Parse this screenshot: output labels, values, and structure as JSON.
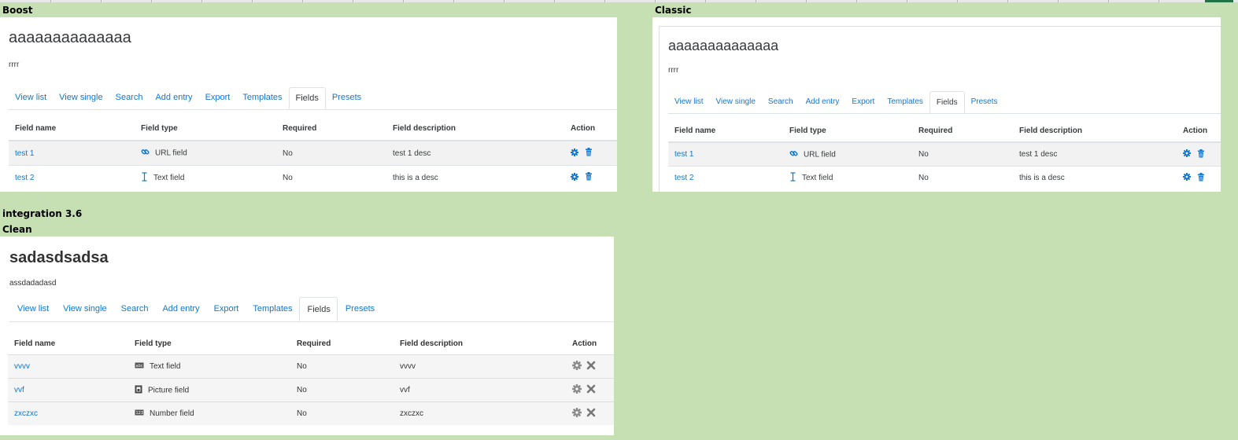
{
  "labels": {
    "boost": "Boost",
    "classic": "Classic",
    "integration": "integration 3.6",
    "clean": "Clean"
  },
  "boost": {
    "title": "aaaaaaaaaaaaaa",
    "description": "rrrr",
    "tabs": [
      {
        "label": "View list",
        "active": false
      },
      {
        "label": "View single",
        "active": false
      },
      {
        "label": "Search",
        "active": false
      },
      {
        "label": "Add entry",
        "active": false
      },
      {
        "label": "Export",
        "active": false
      },
      {
        "label": "Templates",
        "active": false
      },
      {
        "label": "Fields",
        "active": true
      },
      {
        "label": "Presets",
        "active": false
      }
    ],
    "headers": [
      "Field name",
      "Field type",
      "Required",
      "Field description",
      "Action"
    ],
    "rows": [
      {
        "name": "test 1",
        "type_icon": "link-icon",
        "type": "URL field",
        "required": "No",
        "description": "test 1 desc"
      },
      {
        "name": "test 2",
        "type_icon": "text-cursor-icon",
        "type": "Text field",
        "required": "No",
        "description": "this is a desc"
      }
    ]
  },
  "classic": {
    "title": "aaaaaaaaaaaaaa",
    "description": "rrrr",
    "tabs": [
      {
        "label": "View list",
        "active": false
      },
      {
        "label": "View single",
        "active": false
      },
      {
        "label": "Search",
        "active": false
      },
      {
        "label": "Add entry",
        "active": false
      },
      {
        "label": "Export",
        "active": false
      },
      {
        "label": "Templates",
        "active": false
      },
      {
        "label": "Fields",
        "active": true
      },
      {
        "label": "Presets",
        "active": false
      }
    ],
    "headers": [
      "Field name",
      "Field type",
      "Required",
      "Field description",
      "Action"
    ],
    "rows": [
      {
        "name": "test 1",
        "type_icon": "link-icon",
        "type": "URL field",
        "required": "No",
        "description": "test 1 desc"
      },
      {
        "name": "test 2",
        "type_icon": "text-cursor-icon",
        "type": "Text field",
        "required": "No",
        "description": "this is a desc"
      }
    ]
  },
  "clean": {
    "title": "sadasdsadsa",
    "description": "assdadadasd",
    "tabs": [
      {
        "label": "View list",
        "active": false
      },
      {
        "label": "View single",
        "active": false
      },
      {
        "label": "Search",
        "active": false
      },
      {
        "label": "Add entry",
        "active": false
      },
      {
        "label": "Export",
        "active": false
      },
      {
        "label": "Templates",
        "active": false
      },
      {
        "label": "Fields",
        "active": true
      },
      {
        "label": "Presets",
        "active": false
      }
    ],
    "headers": [
      "Field name",
      "Field type",
      "Required",
      "Field description",
      "Action"
    ],
    "rows": [
      {
        "name": "vvvv",
        "type_icon": "text-field-icon",
        "type": "Text field",
        "required": "No",
        "description": "vvvv"
      },
      {
        "name": "vvf",
        "type_icon": "picture-field-icon",
        "type": "Picture field",
        "required": "No",
        "description": "vvf"
      },
      {
        "name": "zxczxc",
        "type_icon": "number-field-icon",
        "type": "Number field",
        "required": "No",
        "description": "zxczxc"
      }
    ]
  },
  "colors": {
    "background": "#c6e0b4",
    "link": "#1177d1",
    "text": "#373a3c",
    "row_stripe": "#f2f2f2",
    "clean_action_icon": "#8a8a8a"
  }
}
